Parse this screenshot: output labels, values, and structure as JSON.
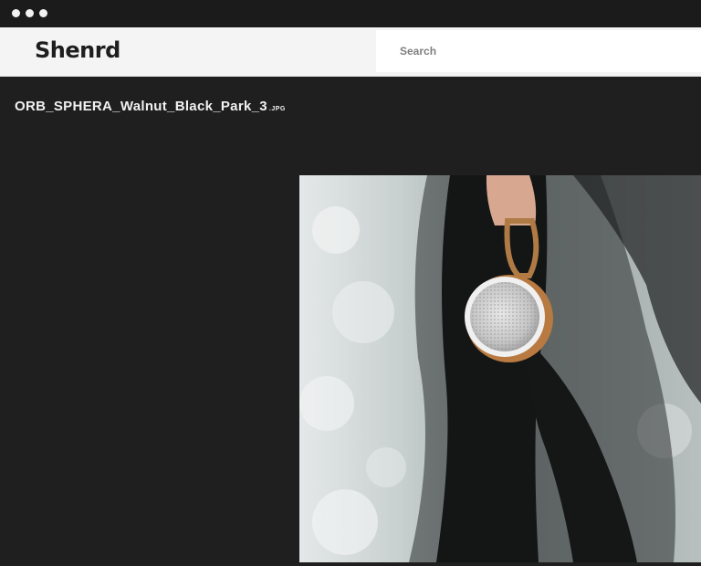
{
  "window": {
    "controls": [
      "dot",
      "dot",
      "dot"
    ]
  },
  "header": {
    "logo": "Shenrd",
    "search_placeholder": "Search"
  },
  "file": {
    "name": "ORB_SPHERA_Walnut_Black_Park_3",
    "extension": ".JPG"
  },
  "icons": [
    "window-dot-icon"
  ]
}
